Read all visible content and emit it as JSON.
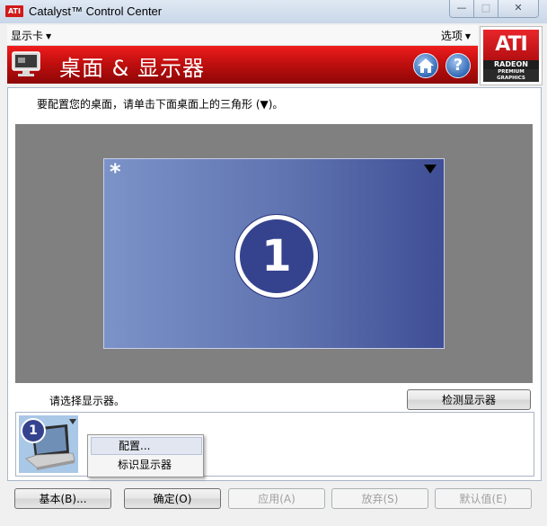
{
  "window": {
    "title": "Catalyst™ Control Center",
    "app_icon_text": "ATI",
    "minimize": "—",
    "maximize": "□",
    "close": "✕"
  },
  "menu": {
    "left": "显示卡",
    "right": "选项"
  },
  "header": {
    "title": "桌面 & 显示器",
    "help_glyph": "?"
  },
  "logo": {
    "brand": "ATI",
    "line1": "RADEON",
    "line2": "PREMIUM",
    "line3": "GRAPHICS"
  },
  "content": {
    "instruction": "要配置您的桌面，请单击下面桌面上的三角形 (▼)。",
    "monitor_marker": "*",
    "monitor_number": "1",
    "select_label": "请选择显示器。",
    "detect_button": "检测显示器",
    "thumb_number": "1"
  },
  "context_menu": {
    "items": [
      "配置...",
      "标识显示器"
    ]
  },
  "buttons": {
    "basic": "基本(B)...",
    "ok": "确定(O)",
    "apply": "应用(A)",
    "discard": "放弃(S)",
    "defaults": "默认值(E)"
  },
  "colors": {
    "header_red": "#c10f0f",
    "monitor_blue": "#5f73b0",
    "badge_blue": "#35438f"
  }
}
